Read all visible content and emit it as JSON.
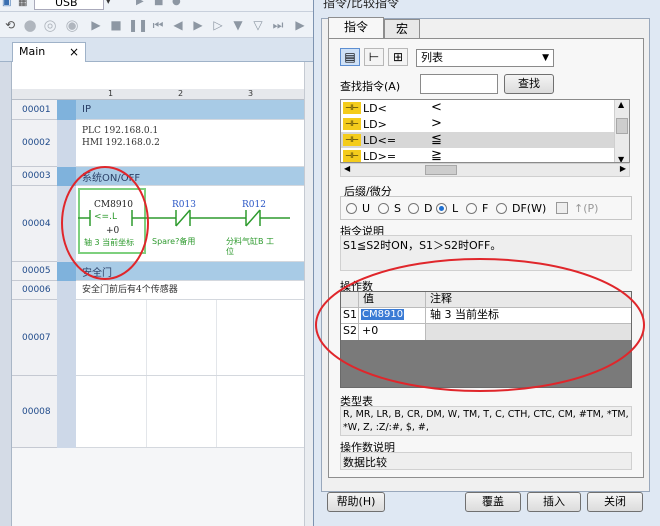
{
  "editor": {
    "port": "USB",
    "tab_label": "Main",
    "tab_close": "×",
    "column_numbers": [
      "1",
      "2",
      "3"
    ],
    "rows": [
      {
        "num": "00001",
        "type": "header",
        "text": "IP"
      },
      {
        "num": "00002",
        "type": "comment",
        "lines": [
          "PLC 192.168.0.1",
          "HMI 192.168.0.2"
        ]
      },
      {
        "num": "00003",
        "type": "header",
        "text": "系统ON/OFF"
      },
      {
        "num": "00004",
        "type": "ladder"
      },
      {
        "num": "00005",
        "type": "header",
        "text": "安全门"
      },
      {
        "num": "00006",
        "type": "comment",
        "lines": [
          "安全门前后有4个传感器"
        ]
      },
      {
        "num": "00007",
        "type": "empty"
      },
      {
        "num": "00008",
        "type": "empty"
      }
    ],
    "contact1": {
      "name": "CM8910",
      "op": "<=.L",
      "value": "+0",
      "comment": "轴 3 当前坐标"
    },
    "contact2": {
      "name": "R013",
      "comment": "Spare?备用"
    },
    "contact3": {
      "name": "R012",
      "comment_line1": "分料气缸B 工",
      "comment_line2": "位"
    }
  },
  "dialog": {
    "title": "指令/比较指令",
    "tabs": [
      "指令",
      "宏"
    ],
    "view_select": "列表",
    "search_label": "查找指令(A)",
    "search_value": "",
    "search_button": "查找",
    "instr_list": [
      {
        "name": "LD<",
        "sym": "<"
      },
      {
        "name": "LD>",
        "sym": ">"
      },
      {
        "name": "LD<=",
        "sym": "≦"
      },
      {
        "name": "LD>=",
        "sym": "≧"
      }
    ],
    "suffix_label": "后缀/微分",
    "suffix_options": [
      "U",
      "S",
      "D",
      "L",
      "F",
      "DF(W)"
    ],
    "suffix_selected": "L",
    "edge_label": "↑(P)",
    "desc_label": "指令说明",
    "desc_text": "S1≦S2时ON，S1＞S2时OFF。",
    "operand_label": "操作数",
    "operand_headers": [
      "值",
      "注释"
    ],
    "operands": [
      {
        "id": "S1",
        "value": "CM8910",
        "comment": "轴 3 当前坐标"
      },
      {
        "id": "S2",
        "value": "+0",
        "comment": ""
      }
    ],
    "type_label": "类型表",
    "type_text_line1": "R, MR, LR, B, CR, DM, W, TM, T, C, CTH, CTC, CM, #TM, *TM, *DM,",
    "type_text_line2": "*W, Z, :Z/:#, $, #,",
    "operand_desc_label": "操作数说明",
    "operand_desc_text": "数据比较",
    "help_button": "帮助(H)",
    "overwrite_button": "覆盖",
    "insert_button": "插入",
    "close_button": "关闭"
  },
  "colors": {
    "accent_red": "#e0262b",
    "header_blue": "#a8cbe6",
    "contact_green": "#2e9a2e",
    "contact_blue": "#2a56c6",
    "selection_blue": "#3a7bd5"
  }
}
